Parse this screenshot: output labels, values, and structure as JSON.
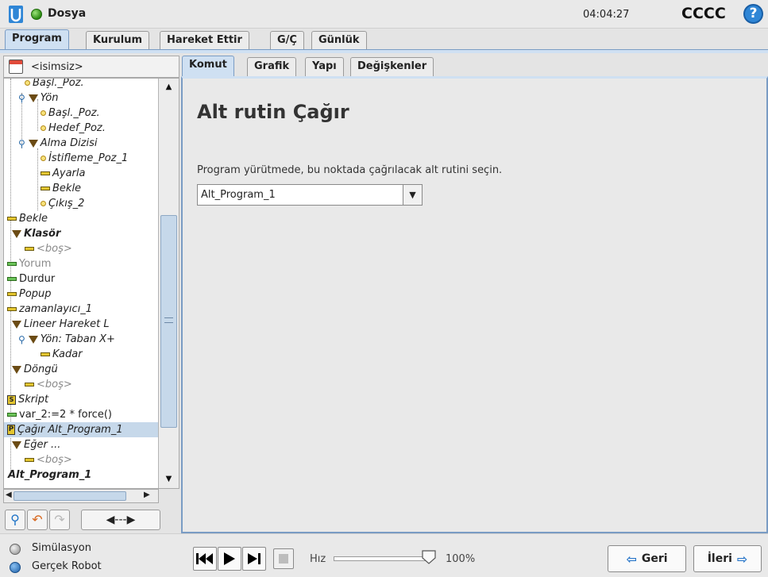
{
  "topbar": {
    "file_menu": "Dosya",
    "clock": "04:04:27",
    "robot_name": "CCCC",
    "help_symbol": "?"
  },
  "main_tabs": [
    "Program",
    "Kurulum",
    "Hareket Ettir",
    "G/Ç",
    "Günlük"
  ],
  "main_tab_active": "Program",
  "program": {
    "name": "<isimsiz>"
  },
  "tree": [
    {
      "label": "Başl._Poz.",
      "icon": "waypoint-icon",
      "style": "italic"
    },
    {
      "label": "Yön",
      "icon": "folder-triangle-icon",
      "style": "italic"
    },
    {
      "label": "Başl._Poz.",
      "icon": "waypoint-icon",
      "style": "italic"
    },
    {
      "label": "Hedef_Poz.",
      "icon": "waypoint-icon",
      "style": "italic"
    },
    {
      "label": "Alma Dizisi",
      "icon": "folder-triangle-icon",
      "style": "italic"
    },
    {
      "label": "İstifleme_Poz_1",
      "icon": "waypoint-icon",
      "style": "italic"
    },
    {
      "label": "Ayarla",
      "icon": "command-bar-icon",
      "style": "italic"
    },
    {
      "label": "Bekle",
      "icon": "command-bar-icon",
      "style": "italic"
    },
    {
      "label": "Çıkış_2",
      "icon": "waypoint-icon",
      "style": "italic"
    },
    {
      "label": "Bekle",
      "icon": "command-bar-icon",
      "style": "italic"
    },
    {
      "label": "Klasör",
      "icon": "folder-triangle-icon",
      "style": "bold-italic"
    },
    {
      "label": "<boş>",
      "icon": "command-bar-icon",
      "style": "italic-gray"
    },
    {
      "label": "Yorum",
      "icon": "comment-bar-icon",
      "style": "gray"
    },
    {
      "label": "Durdur",
      "icon": "halt-bar-icon",
      "style": "normal"
    },
    {
      "label": "Popup",
      "icon": "command-bar-icon",
      "style": "italic"
    },
    {
      "label": "zamanlayıcı_1",
      "icon": "command-bar-icon",
      "style": "italic"
    },
    {
      "label": "Lineer Hareket L",
      "icon": "folder-triangle-icon",
      "style": "italic"
    },
    {
      "label": "Yön: Taban X+",
      "icon": "folder-triangle-icon",
      "style": "italic"
    },
    {
      "label": "Kadar",
      "icon": "command-bar-icon",
      "style": "italic"
    },
    {
      "label": "Döngü",
      "icon": "folder-triangle-icon",
      "style": "italic"
    },
    {
      "label": "<boş>",
      "icon": "command-bar-icon",
      "style": "italic-gray"
    },
    {
      "label": "Skript",
      "icon": "script-icon",
      "style": "italic"
    },
    {
      "label": "var_2:=2 * force()",
      "icon": "assignment-bar-icon",
      "style": "normal"
    },
    {
      "label": "Çağır Alt_Program_1",
      "icon": "call-icon",
      "style": "italic"
    },
    {
      "label": "Eğer ...",
      "icon": "folder-triangle-icon",
      "style": "italic"
    },
    {
      "label": "<boş>",
      "icon": "command-bar-icon",
      "style": "italic-gray"
    },
    {
      "label": "Alt_Program_1",
      "icon": "none",
      "style": "bold-italic"
    }
  ],
  "selected_tree_item": "Çağır Alt_Program_1",
  "sub_tabs": [
    "Komut",
    "Grafik",
    "Yapı",
    "Değişkenler"
  ],
  "sub_tab_active": "Komut",
  "content": {
    "title": "Alt rutin Çağır",
    "instruction": "Program yürütmede, bu noktada çağrılacak alt rutini seçin.",
    "selected_subprogram": "Alt_Program_1"
  },
  "bottom": {
    "simulation_label": "Simülasyon",
    "real_robot_label": "Gerçek Robot",
    "speed_label": "Hız",
    "speed_value": "100%",
    "speed_fraction": 1.0,
    "back_label": "Geri",
    "next_label": "İleri"
  },
  "colors": {
    "selected_tab": "#cfe0f2",
    "waypoint": "#f7e27a",
    "command_bar": "#e4c630",
    "folder_triangle": "#6b4b14",
    "run_indicator": "#2b8a12",
    "accent_blue": "#2a77c9"
  }
}
